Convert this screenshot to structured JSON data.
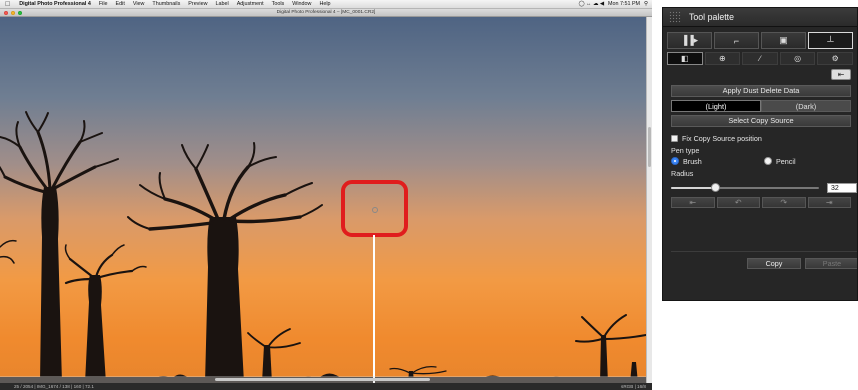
{
  "menubar": {
    "apple": "",
    "app_name": "Digital Photo Professional 4",
    "items": [
      "File",
      "Edit",
      "View",
      "Thumbnails",
      "Preview",
      "Label",
      "Adjustment",
      "Tools",
      "Window",
      "Help"
    ],
    "status_icons": "◯ ↔ ☁ ◀",
    "clock": "Mon 7:51 PM"
  },
  "window": {
    "title": "Digital Photo Professional 4 – [MC_0001.CR2]"
  },
  "statusbar": {
    "left": "25 / 2054  |  IMG_1674 / 138  |  160  |  72.1",
    "right": "sRGB | 16/8"
  },
  "palette": {
    "title": "Tool palette",
    "tabs_top": [
      {
        "icon": "basic-adjust-icon",
        "glyph": "▐▐▸"
      },
      {
        "icon": "crop-icon",
        "glyph": "⌐"
      },
      {
        "icon": "image-icon",
        "glyph": "▣"
      },
      {
        "icon": "stamp-icon",
        "glyph": "┴"
      }
    ],
    "tabs_sub": [
      {
        "icon": "split-view-icon",
        "glyph": "◧"
      },
      {
        "icon": "magnify-icon",
        "glyph": "⊕"
      },
      {
        "icon": "tone-curve-icon",
        "glyph": "∕"
      },
      {
        "icon": "color-wheel-icon",
        "glyph": "◎"
      },
      {
        "icon": "gear-icon",
        "glyph": "⚙"
      }
    ],
    "undo_all_glyph": "⇤",
    "apply_dust": "Apply Dust Delete Data",
    "light": "(Light)",
    "dark": "(Dark)",
    "select_copy_source": "Select Copy Source",
    "fix_copy_source": "Fix Copy Source position",
    "pen_type_label": "Pen type",
    "pen_brush": "Brush",
    "pen_pencil": "Pencil",
    "radius_label": "Radius",
    "radius_value": "32",
    "radius_fraction": 0.3,
    "history_glyphs": [
      "⇤",
      "↶",
      "↷",
      "⇥"
    ],
    "copy": "Copy",
    "paste": "Paste"
  },
  "colors": {
    "highlight_ring": "#e01d1d",
    "sky_top": "#5b6f8f",
    "sky_horizon": "#f0923a",
    "silhouette": "#1a1310",
    "radio_selected": "#3b86f5"
  }
}
